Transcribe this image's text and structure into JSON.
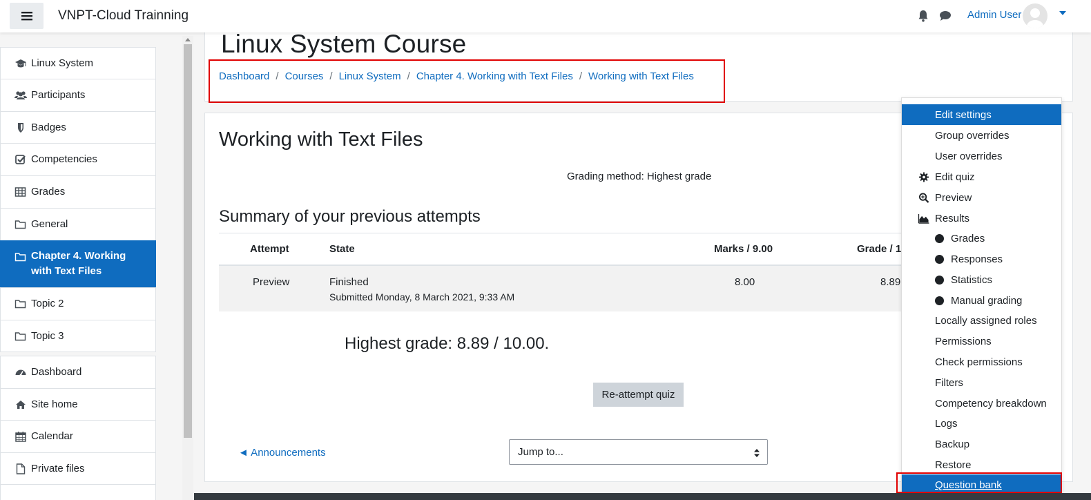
{
  "header": {
    "site_title": "VNPT-Cloud Trainning",
    "user_name": "Admin User"
  },
  "drawer": {
    "items": [
      {
        "label": "Linux System",
        "icon": "graduation-cap-icon"
      },
      {
        "label": "Participants",
        "icon": "users-icon"
      },
      {
        "label": "Badges",
        "icon": "shield-icon"
      },
      {
        "label": "Competencies",
        "icon": "check-square-icon"
      },
      {
        "label": "Grades",
        "icon": "table-icon"
      },
      {
        "label": "General",
        "icon": "folder-icon"
      },
      {
        "label": "Chapter 4. Working with Text Files",
        "icon": "folder-icon",
        "active": true
      },
      {
        "label": "Topic 2",
        "icon": "folder-icon"
      },
      {
        "label": "Topic 3",
        "icon": "folder-icon"
      },
      {
        "label": "Dashboard",
        "icon": "tachometer-icon"
      },
      {
        "label": "Site home",
        "icon": "home-icon"
      },
      {
        "label": "Calendar",
        "icon": "calendar-icon"
      },
      {
        "label": "Private files",
        "icon": "file-icon"
      }
    ]
  },
  "page": {
    "course_title": "Linux System Course",
    "breadcrumb": [
      "Dashboard",
      "Courses",
      "Linux System",
      "Chapter 4. Working with Text Files",
      "Working with Text Files"
    ],
    "breadcrumb_sep": "/"
  },
  "quiz": {
    "title": "Working with Text Files",
    "grading_method": "Grading method: Highest grade",
    "summary_heading": "Summary of your previous attempts",
    "table": {
      "headers": [
        "Attempt",
        "State",
        "Marks / 9.00",
        "Grade / 1"
      ],
      "rows": [
        {
          "attempt": "Preview",
          "state": "Finished",
          "submitted": "Submitted Monday, 8 March 2021, 9:33 AM",
          "marks": "8.00",
          "grade": "8.89"
        }
      ]
    },
    "highest_grade": "Highest grade: 8.89 / 10.00.",
    "reattempt_label": "Re-attempt quiz",
    "announcements_label": "◄ Announcements",
    "jump_placeholder": "Jump to..."
  },
  "settings_menu": {
    "items": [
      {
        "label": "Edit settings",
        "active": true
      },
      {
        "label": "Group overrides"
      },
      {
        "label": "User overrides"
      },
      {
        "label": "Edit quiz",
        "icon": "gear-icon"
      },
      {
        "label": "Preview",
        "icon": "zoom-icon"
      },
      {
        "label": "Results",
        "icon": "area-chart-icon"
      },
      {
        "label": "Grades",
        "sub": true
      },
      {
        "label": "Responses",
        "sub": true
      },
      {
        "label": "Statistics",
        "sub": true
      },
      {
        "label": "Manual grading",
        "sub": true
      },
      {
        "label": "Locally assigned roles"
      },
      {
        "label": "Permissions"
      },
      {
        "label": "Check permissions"
      },
      {
        "label": "Filters"
      },
      {
        "label": "Competency breakdown"
      },
      {
        "label": "Logs"
      },
      {
        "label": "Backup"
      },
      {
        "label": "Restore"
      },
      {
        "label": "Question bank",
        "active": true
      }
    ]
  },
  "colors": {
    "brand_blue": "#0f6cbf",
    "highlight_red": "#e00000"
  }
}
